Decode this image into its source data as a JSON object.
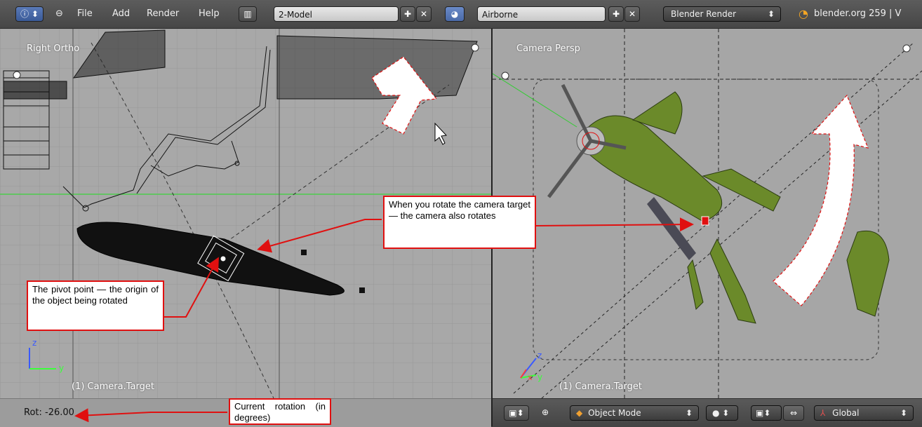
{
  "menu": {
    "file": "File",
    "add": "Add",
    "render": "Render",
    "help": "Help"
  },
  "screen_layout": "2-Model",
  "scene": "Airborne",
  "render_engine": "Blender Render",
  "version_info": "blender.org 259 | V",
  "left_view": {
    "label": "Right Ortho",
    "object_label": "(1) Camera.Target",
    "axis_z": "z",
    "axis_y": "y"
  },
  "right_view": {
    "label": "Camera Persp",
    "object_label": "(1) Camera.Target",
    "axis_z": "z",
    "axis_y": "y",
    "axis_x": "x"
  },
  "status": {
    "rotation": "Rot: -26.00"
  },
  "header": {
    "mode": "Object Mode",
    "orientation": "Global"
  },
  "callouts": {
    "camera_target": "When you rotate the camera target — the camera also rotates",
    "pivot": "The pivot point — the origin of the object being rotated",
    "rotation": "Current rotation (in degrees)"
  },
  "colors": {
    "viewport_bg": "#a8a8a8",
    "callout_border": "#e01010",
    "plane_green": "#6b8a2a"
  },
  "icons": [
    "info-icon",
    "minus-icon",
    "layout-icon",
    "plus-icon",
    "x-icon",
    "scene-icon",
    "blender-logo-icon",
    "cube-icon",
    "sphere-icon",
    "snap-icon",
    "transform-axes-icon"
  ]
}
